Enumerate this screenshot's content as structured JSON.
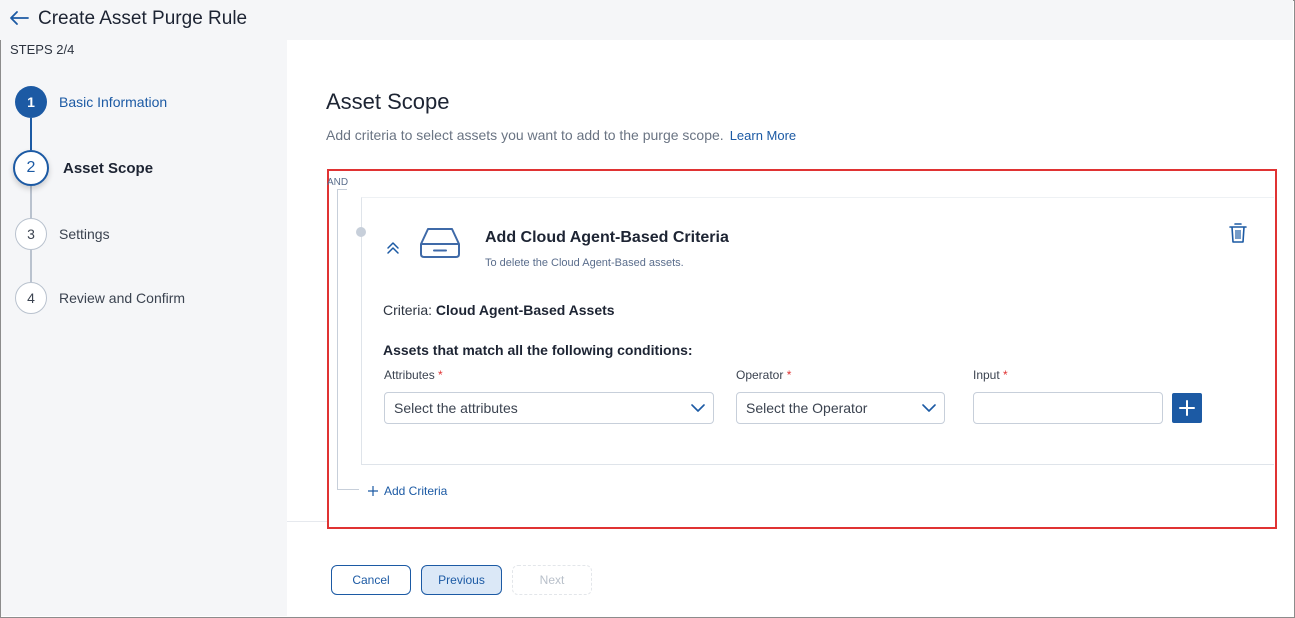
{
  "header": {
    "title": "Create Asset Purge Rule"
  },
  "steps": {
    "progress_label": "STEPS 2/4",
    "items": [
      {
        "number": "1",
        "label": "Basic Information",
        "state": "completed"
      },
      {
        "number": "2",
        "label": "Asset Scope",
        "state": "active"
      },
      {
        "number": "3",
        "label": "Settings",
        "state": "pending"
      },
      {
        "number": "4",
        "label": "Review and Confirm",
        "state": "pending"
      }
    ]
  },
  "main": {
    "title": "Asset Scope",
    "subtitle": "Add criteria to select assets you want to add to the purge scope.",
    "learn_more": "Learn More",
    "logic_operator": "AND",
    "card": {
      "title": "Add Cloud Agent-Based Criteria",
      "description": "To delete the Cloud Agent-Based assets.",
      "criteria_prefix": "Criteria:",
      "criteria_value": "Cloud Agent-Based Assets",
      "conditions_title": "Assets that match all the following conditions:",
      "fields": {
        "attributes": {
          "label": "Attributes",
          "required_mark": "*",
          "placeholder": "Select the attributes"
        },
        "operator": {
          "label": "Operator",
          "required_mark": "*",
          "placeholder": "Select the Operator"
        },
        "input": {
          "label": "Input",
          "required_mark": "*",
          "value": ""
        }
      }
    },
    "add_criteria": "Add Criteria"
  },
  "footer": {
    "cancel": "Cancel",
    "previous": "Previous",
    "next": "Next"
  },
  "colors": {
    "accent": "#1c5aa4",
    "highlight_border": "#e03333",
    "required": "#e03333"
  },
  "icons": [
    "back-arrow-icon",
    "chevron-double-up-icon",
    "drive-icon",
    "trash-icon",
    "chevron-down-icon",
    "plus-icon"
  ]
}
